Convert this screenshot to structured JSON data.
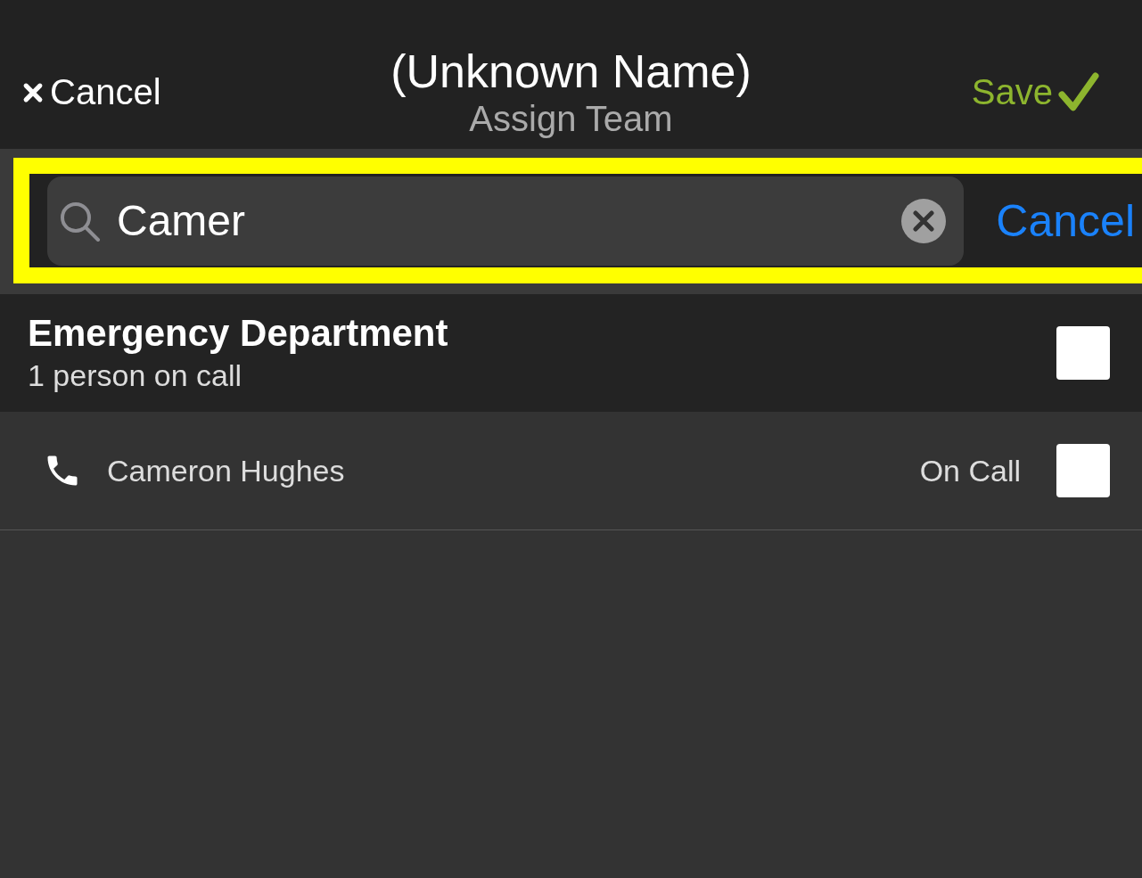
{
  "header": {
    "cancel": "Cancel",
    "title": "(Unknown Name)",
    "subtitle": "Assign Team",
    "save": "Save"
  },
  "search": {
    "value": "Camer",
    "cancel": "Cancel",
    "highlighted": true
  },
  "groups": [
    {
      "name": "Emergency Department",
      "summary": "1 person on call",
      "checked": false,
      "members": [
        {
          "name": "Cameron Hughes",
          "status": "On Call",
          "checked": false
        }
      ]
    }
  ]
}
